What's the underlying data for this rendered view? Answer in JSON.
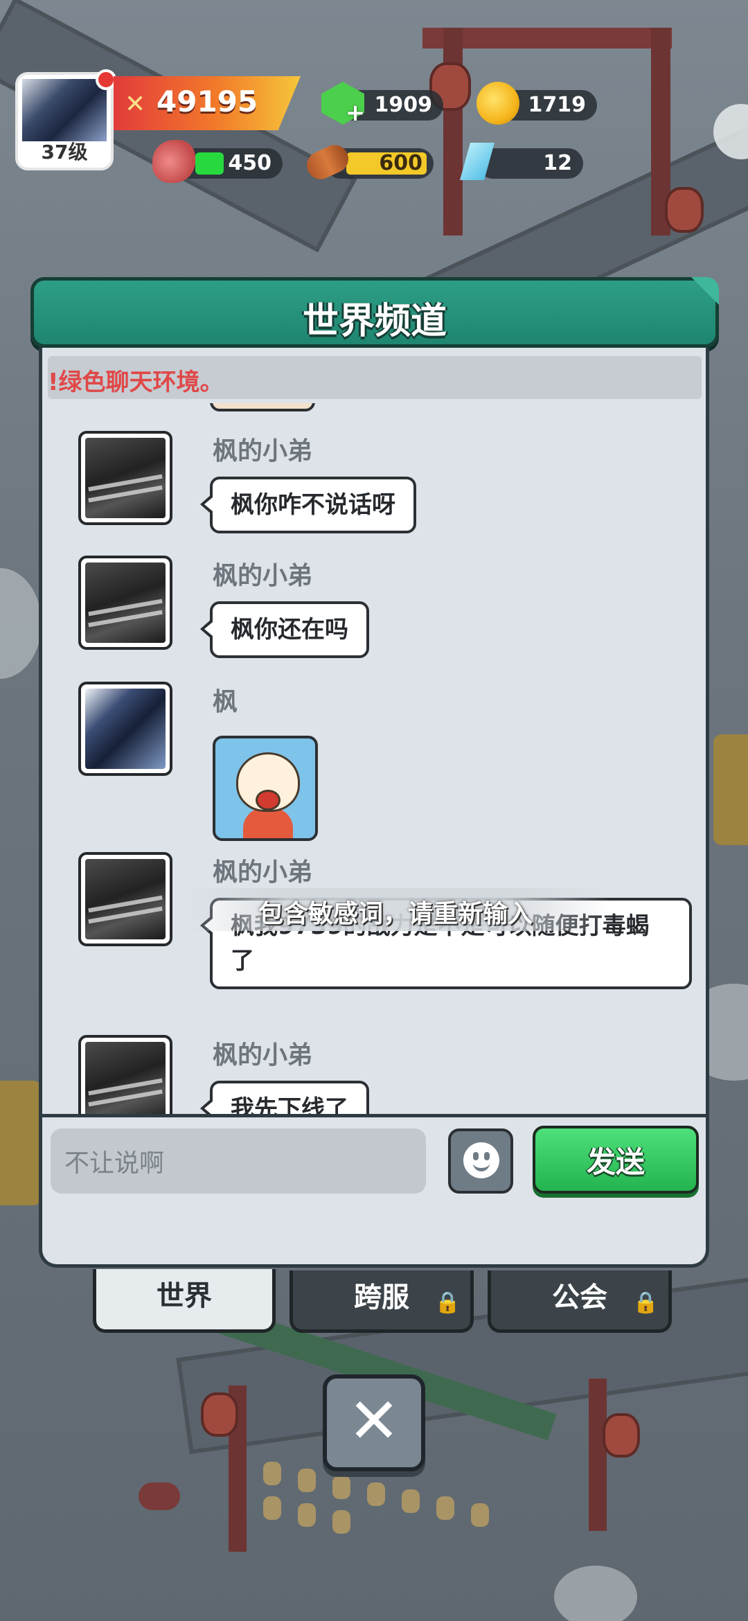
{
  "hud": {
    "level": "37级",
    "power": "49195",
    "gems": "1909",
    "coins": "1719",
    "meat": "450",
    "meat_fill": 0.35,
    "wood": "600",
    "wood_fill": 1.0,
    "crystals": "12"
  },
  "dialog": {
    "title": "世界频道",
    "notice": "!绿色聊天环境。"
  },
  "messages": [
    {
      "name": "枫的小弟",
      "text": "枫你咋不说话呀"
    },
    {
      "name": "枫的小弟",
      "text": "枫你还在吗"
    },
    {
      "name": "枫",
      "sticker": "crying-character-sticker"
    },
    {
      "name": "枫的小弟",
      "text": "枫我9739的战力是不是可以随便打毒蝎了"
    },
    {
      "name": "枫的小弟",
      "text": "我先下线了"
    }
  ],
  "toast": "包含敏感词，请重新输入",
  "input": {
    "value": "不让说啊",
    "send_label": "发送"
  },
  "tabs": [
    {
      "label": "世界",
      "active": true,
      "locked": false
    },
    {
      "label": "跨服",
      "active": false,
      "locked": true
    },
    {
      "label": "公会",
      "active": false,
      "locked": true
    }
  ],
  "icons": {
    "power": "crossed-swords-icon",
    "gems": "green-gem-icon",
    "coins": "gold-coin-icon",
    "meat": "meat-icon",
    "wood": "wood-log-icon",
    "crystals": "blue-crystal-icon",
    "lock": "lock-icon",
    "close": "close-icon",
    "emoji": "emoji-icon"
  },
  "colors": {
    "accent": "#2e9e86",
    "send": "#2fc25b",
    "notice": "#e04848"
  }
}
